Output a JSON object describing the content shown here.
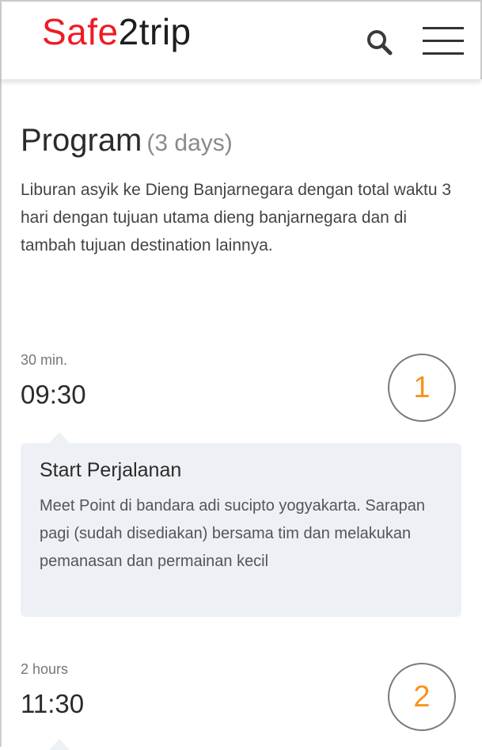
{
  "header": {
    "logo": {
      "part1": "Safe",
      "part2": "2trip"
    },
    "search_icon": "search-icon",
    "menu_icon": "hamburger-menu-icon"
  },
  "program": {
    "title": "Program",
    "days": "(3 days)",
    "description": "Liburan asyik ke Dieng Banjarnegara dengan total waktu 3 hari dengan tujuan utama dieng banjarnegara dan di tambah tujuan destination lainnya."
  },
  "itinerary": [
    {
      "duration": "30 min.",
      "time": "09:30",
      "step": "1",
      "title": "Start Perjalanan",
      "description": "Meet Point di bandara adi sucipto yogyakarta. Sarapan pagi (sudah disediakan) bersama tim dan melakukan pemanasan dan permainan kecil"
    },
    {
      "duration": "2 hours",
      "time": "11:30",
      "step": "2"
    }
  ],
  "colors": {
    "brand_red": "#ee1c25",
    "accent_orange": "#f7941d",
    "card_bg": "#edf1f5"
  }
}
